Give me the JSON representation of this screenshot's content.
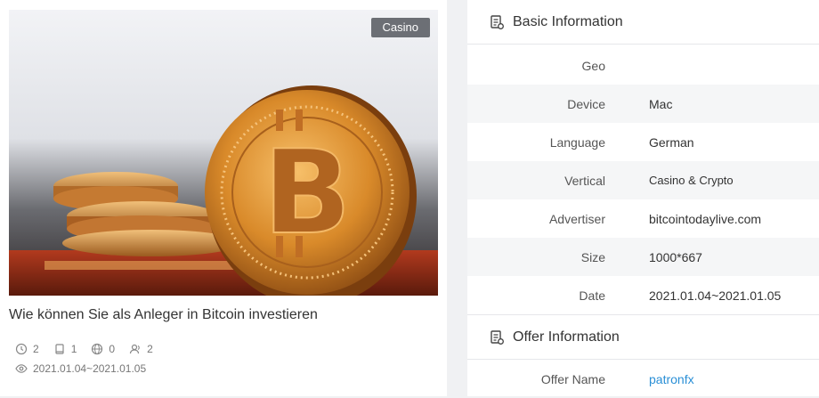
{
  "card": {
    "badge": "Casino",
    "title": "Wie können Sie als Anleger in Bitcoin investieren",
    "stats": {
      "views_time": "2",
      "pages": "1",
      "geos": "0",
      "users": "2"
    },
    "date_range": "2021.01.04~2021.01.05"
  },
  "basic": {
    "heading": "Basic Information",
    "rows": [
      {
        "label": "Geo",
        "value": ""
      },
      {
        "label": "Device",
        "value": "Mac"
      },
      {
        "label": "Language",
        "value": "German"
      },
      {
        "label": "Vertical",
        "value": "Casino & Crypto"
      },
      {
        "label": "Advertiser",
        "value": "bitcointodaylive.com"
      },
      {
        "label": "Size",
        "value": "1000*667"
      },
      {
        "label": "Date",
        "value": "2021.01.04~2021.01.05"
      }
    ]
  },
  "offer": {
    "heading": "Offer Information",
    "rows": [
      {
        "label": "Offer Name",
        "value": "patronfx"
      }
    ]
  },
  "colors": {
    "link": "#2a8fd6",
    "badge_bg": "#6c6f75",
    "coin": "#d88a2c"
  },
  "icons": [
    "clock-icon",
    "book-icon",
    "globe-icon",
    "users-icon",
    "eye-icon",
    "document-icon"
  ]
}
